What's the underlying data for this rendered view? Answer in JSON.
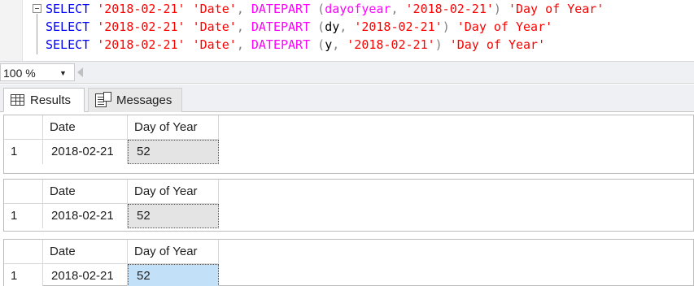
{
  "editor": {
    "lines": [
      {
        "select": "SELECT",
        "date_literal": "'2018-02-21'",
        "date_alias": "'Date'",
        "comma": ",",
        "func": "DATEPART",
        "open_paren": "(",
        "datepart": "dayofyear",
        "arg_comma": ",",
        "arg_date": "'2018-02-21'",
        "close_paren": ")",
        "alias": "'Day of Year'"
      },
      {
        "select": "SELECT",
        "date_literal": "'2018-02-21'",
        "date_alias": "'Date'",
        "comma": ",",
        "func": "DATEPART",
        "open_paren": "(",
        "datepart": "dy",
        "arg_comma": ",",
        "arg_date": "'2018-02-21'",
        "close_paren": ")",
        "alias": "'Day of Year'"
      },
      {
        "select": "SELECT",
        "date_literal": "'2018-02-21'",
        "date_alias": "'Date'",
        "comma": ",",
        "func": "DATEPART",
        "open_paren": "(",
        "datepart": "y",
        "arg_comma": ",",
        "arg_date": "'2018-02-21'",
        "close_paren": ")",
        "alias": "'Day of Year'"
      }
    ],
    "colors": {
      "keyword": "#0000ff",
      "string": "#ff0000",
      "function": "#ff00ff",
      "punctuation": "#808080"
    }
  },
  "zoom": {
    "value": "100 %"
  },
  "tabs": {
    "results": "Results",
    "messages": "Messages"
  },
  "results": [
    {
      "headers": [
        "Date",
        "Day of Year"
      ],
      "row_number": "1",
      "date": "2018-02-21",
      "day_of_year": "52"
    },
    {
      "headers": [
        "Date",
        "Day of Year"
      ],
      "row_number": "1",
      "date": "2018-02-21",
      "day_of_year": "52"
    },
    {
      "headers": [
        "Date",
        "Day of Year"
      ],
      "row_number": "1",
      "date": "2018-02-21",
      "day_of_year": "52"
    }
  ],
  "icons": [
    "collapse-icon",
    "grid-icon",
    "messages-icon",
    "dropdown-arrow-icon"
  ],
  "selection_colors": {
    "inactive": "#e4e4e4",
    "active": "#c2e0f7"
  }
}
